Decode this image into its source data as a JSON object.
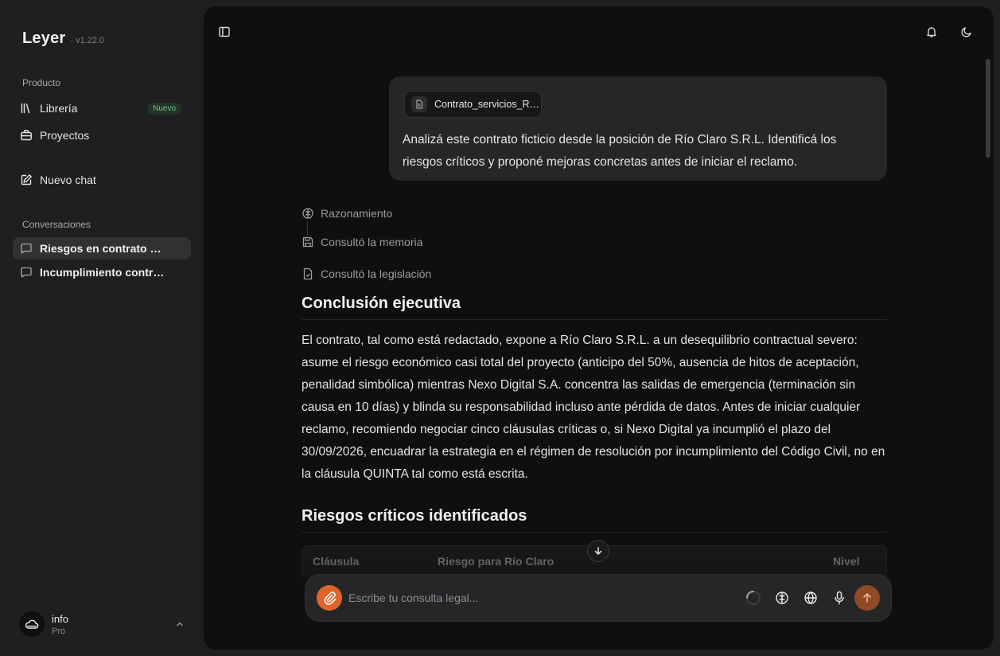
{
  "app": {
    "name": "Leyer",
    "version": "· v1.22.0"
  },
  "sidebar": {
    "product_label": "Producto",
    "items": [
      {
        "label": "Librería",
        "badge": "Nuevo",
        "icon": "library-icon"
      },
      {
        "label": "Proyectos",
        "icon": "briefcase-icon"
      }
    ],
    "new_chat_label": "Nuevo chat",
    "conversations_label": "Conversaciones",
    "conversations": [
      {
        "label": "Riesgos en contrato de servicios",
        "active": true
      },
      {
        "label": "Incumplimiento contractual",
        "active": false
      }
    ]
  },
  "user": {
    "name": "info",
    "plan": "Pro"
  },
  "chat": {
    "user_message": {
      "attachment": "Contrato_servicios_Rio_Claro.pdf",
      "text": "Analizá este contrato ficticio desde la posición de Río Claro S.R.L. Identificá los riesgos críticos y proponé mejoras concretas antes de iniciar el reclamo."
    },
    "steps": [
      {
        "label": "Razonamiento",
        "icon": "brain-icon"
      },
      {
        "label": "Consultó la memoria",
        "icon": "save-icon"
      },
      {
        "label": "Consultó la legislación",
        "icon": "document-check-icon"
      }
    ],
    "sections": [
      {
        "heading": "Conclusión ejecutiva",
        "body": "El contrato, tal como está redactado, expone a Río Claro S.R.L. a un desequilibrio contractual severo: asume el riesgo económico casi total del proyecto (anticipo del 50%, ausencia de hitos de aceptación, penalidad simbólica) mientras Nexo Digital S.A. concentra las salidas de emergencia (terminación sin causa en 10 días) y blinda su responsabilidad incluso ante pérdida de datos. Antes de iniciar cualquier reclamo, recomiendo negociar cinco cláusulas críticas o, si Nexo Digital ya incumplió el plazo del 30/09/2026, encuadrar la estrategia en el régimen de resolución por incumplimiento del Código Civil, no en la cláusula QUINTA tal como está escrita."
      },
      {
        "heading": "Riesgos críticos identificados"
      }
    ],
    "table": {
      "headers": [
        "Cláusula",
        "Riesgo para Río Claro",
        "Nivel"
      ]
    }
  },
  "composer": {
    "placeholder": "Escribe tu consulta legal..."
  },
  "colors": {
    "accent": "#e0642a",
    "badge_text": "#6fbf86",
    "panel_bg": "#0f0f10",
    "sidebar_bg": "#1f1f21"
  }
}
